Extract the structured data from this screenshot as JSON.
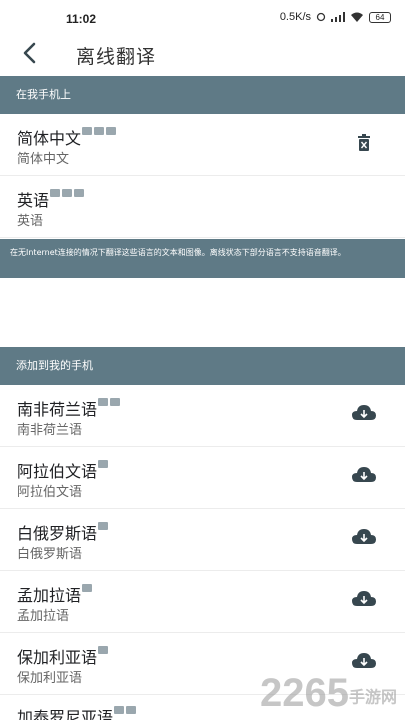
{
  "status_bar": {
    "time": "11:02",
    "network_speed": "0.5K/s",
    "battery": "64"
  },
  "app_bar": {
    "title": "离线翻译",
    "back_icon": "arrow-left-icon"
  },
  "on_device_section": {
    "header": "在我手机上",
    "items": [
      {
        "name": "简体中文",
        "native": "简体中文",
        "tags": [
          "keyboard",
          "camera",
          "download"
        ],
        "action_icon": "delete-icon"
      },
      {
        "name": "英语",
        "native": "英语",
        "tags": [
          "keyboard",
          "camera",
          "download"
        ]
      }
    ]
  },
  "info_banner": "在无Internet连接的情况下翻译这些语言的文本和图像。离线状态下部分语言不支持语音翻译。",
  "add_section": {
    "header": "添加到我的手机",
    "items": [
      {
        "name": "南非荷兰语",
        "native": "南非荷兰语",
        "tags": [
          "keyboard",
          "camera"
        ],
        "action_icon": "cloud-download-icon"
      },
      {
        "name": "阿拉伯文语",
        "native": "阿拉伯文语",
        "tags": [
          "keyboard"
        ],
        "action_icon": "cloud-download-icon"
      },
      {
        "name": "白俄罗斯语",
        "native": "白俄罗斯语",
        "tags": [
          "keyboard"
        ],
        "action_icon": "cloud-download-icon"
      },
      {
        "name": "孟加拉语",
        "native": "孟加拉语",
        "tags": [
          "keyboard"
        ],
        "action_icon": "cloud-download-icon"
      },
      {
        "name": "保加利亚语",
        "native": "保加利亚语",
        "tags": [
          "keyboard"
        ],
        "action_icon": "cloud-download-icon"
      },
      {
        "name": "加泰罗尼亚语",
        "native": "",
        "tags": [
          "keyboard",
          "camera"
        ]
      }
    ]
  },
  "watermark": {
    "number": "2265",
    "suffix": "手游网"
  },
  "colors": {
    "header_bg": "#5f7a86",
    "icon": "#5f6b72"
  }
}
